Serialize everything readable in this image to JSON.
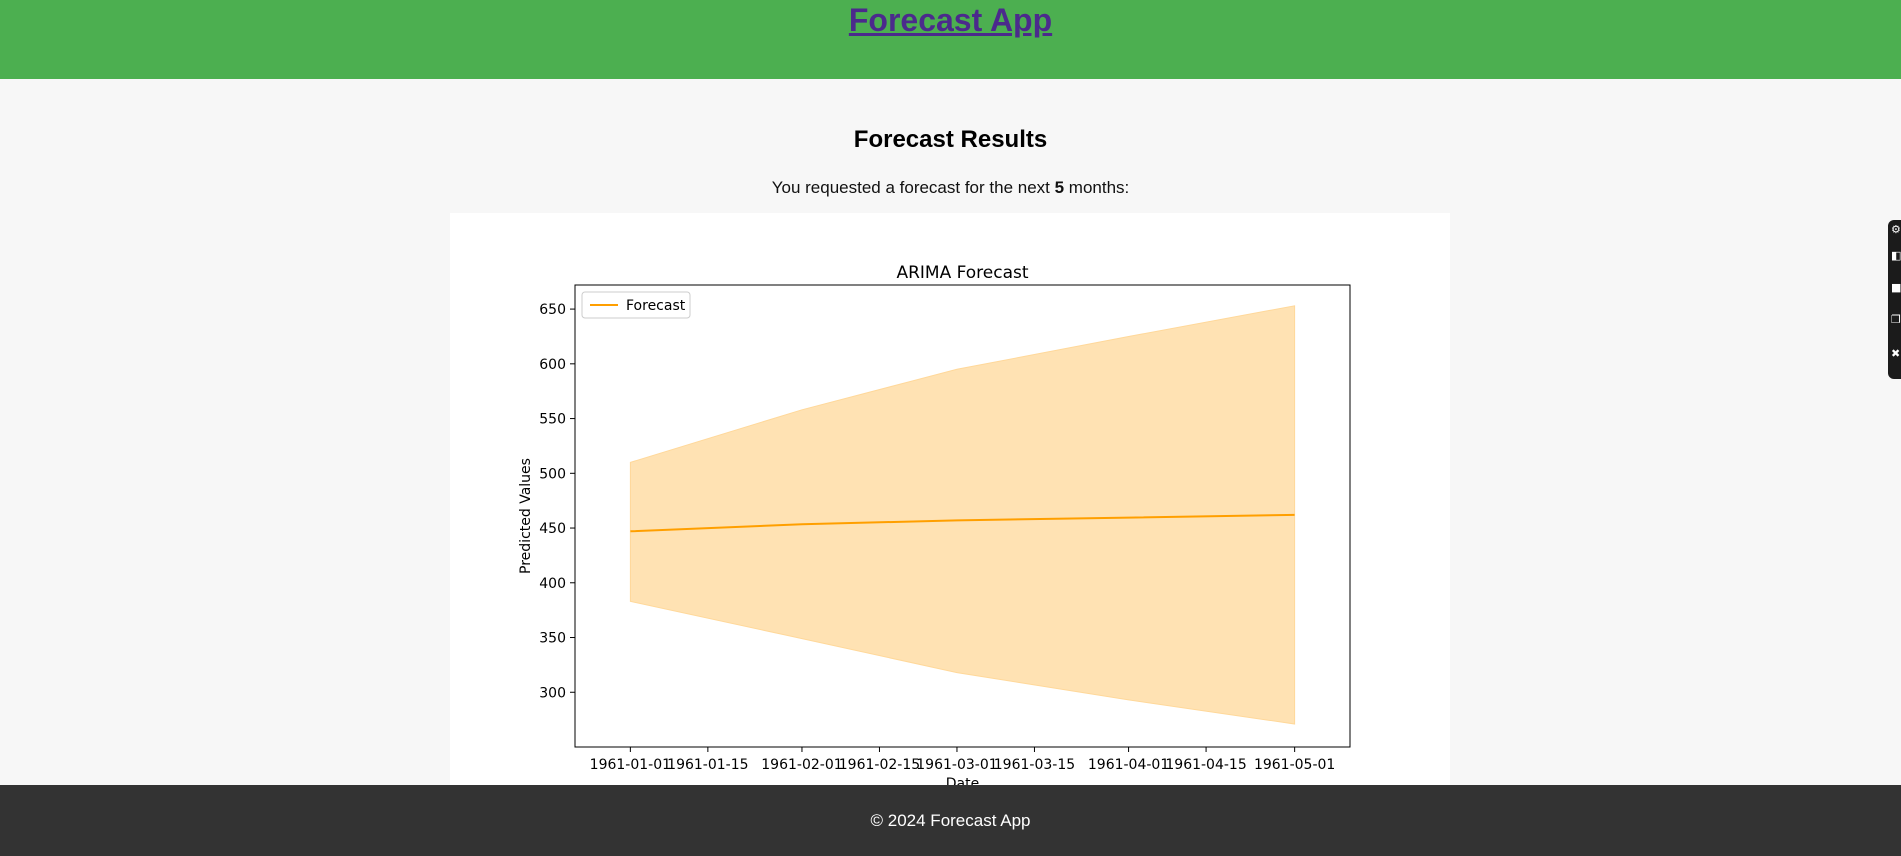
{
  "header": {
    "app_title": "Forecast App"
  },
  "main": {
    "heading": "Forecast Results",
    "intro_prefix": "You requested a forecast for the next ",
    "months": "5",
    "intro_suffix": " months:"
  },
  "footer": {
    "copyright": "© 2024 Forecast App"
  },
  "side_toolbar": {
    "icons": [
      "settings-icon",
      "window-icon",
      "square-icon",
      "copy-icon",
      "tool-icon"
    ]
  },
  "colors": {
    "header_bg": "#4caf50",
    "footer_bg": "#333333",
    "forecast_line": "#ff9f00",
    "confidence_fill": "#ffe2b3"
  },
  "chart_data": {
    "type": "line",
    "title": "ARIMA Forecast",
    "xlabel": "Date",
    "ylabel": "Predicted Values",
    "x_ticks": [
      "1961-01-01",
      "1961-01-15",
      "1961-02-01",
      "1961-02-15",
      "1961-03-01",
      "1961-03-15",
      "1961-04-01",
      "1961-04-15",
      "1961-05-01"
    ],
    "y_ticks": [
      300,
      350,
      400,
      450,
      500,
      550,
      600,
      650
    ],
    "ylim": [
      250,
      672
    ],
    "xlim": [
      "1960-12-22",
      "1961-05-11"
    ],
    "legend": {
      "position": "top-left",
      "entries": [
        "Forecast"
      ]
    },
    "grid": false,
    "series": [
      {
        "name": "Forecast",
        "x": [
          "1961-01-01",
          "1961-02-01",
          "1961-03-01",
          "1961-04-01",
          "1961-05-01"
        ],
        "values": [
          447,
          453.5,
          457,
          459.5,
          462
        ],
        "lower": [
          383,
          349,
          318,
          293,
          271
        ],
        "upper": [
          510,
          558,
          595,
          625,
          653
        ]
      }
    ]
  }
}
